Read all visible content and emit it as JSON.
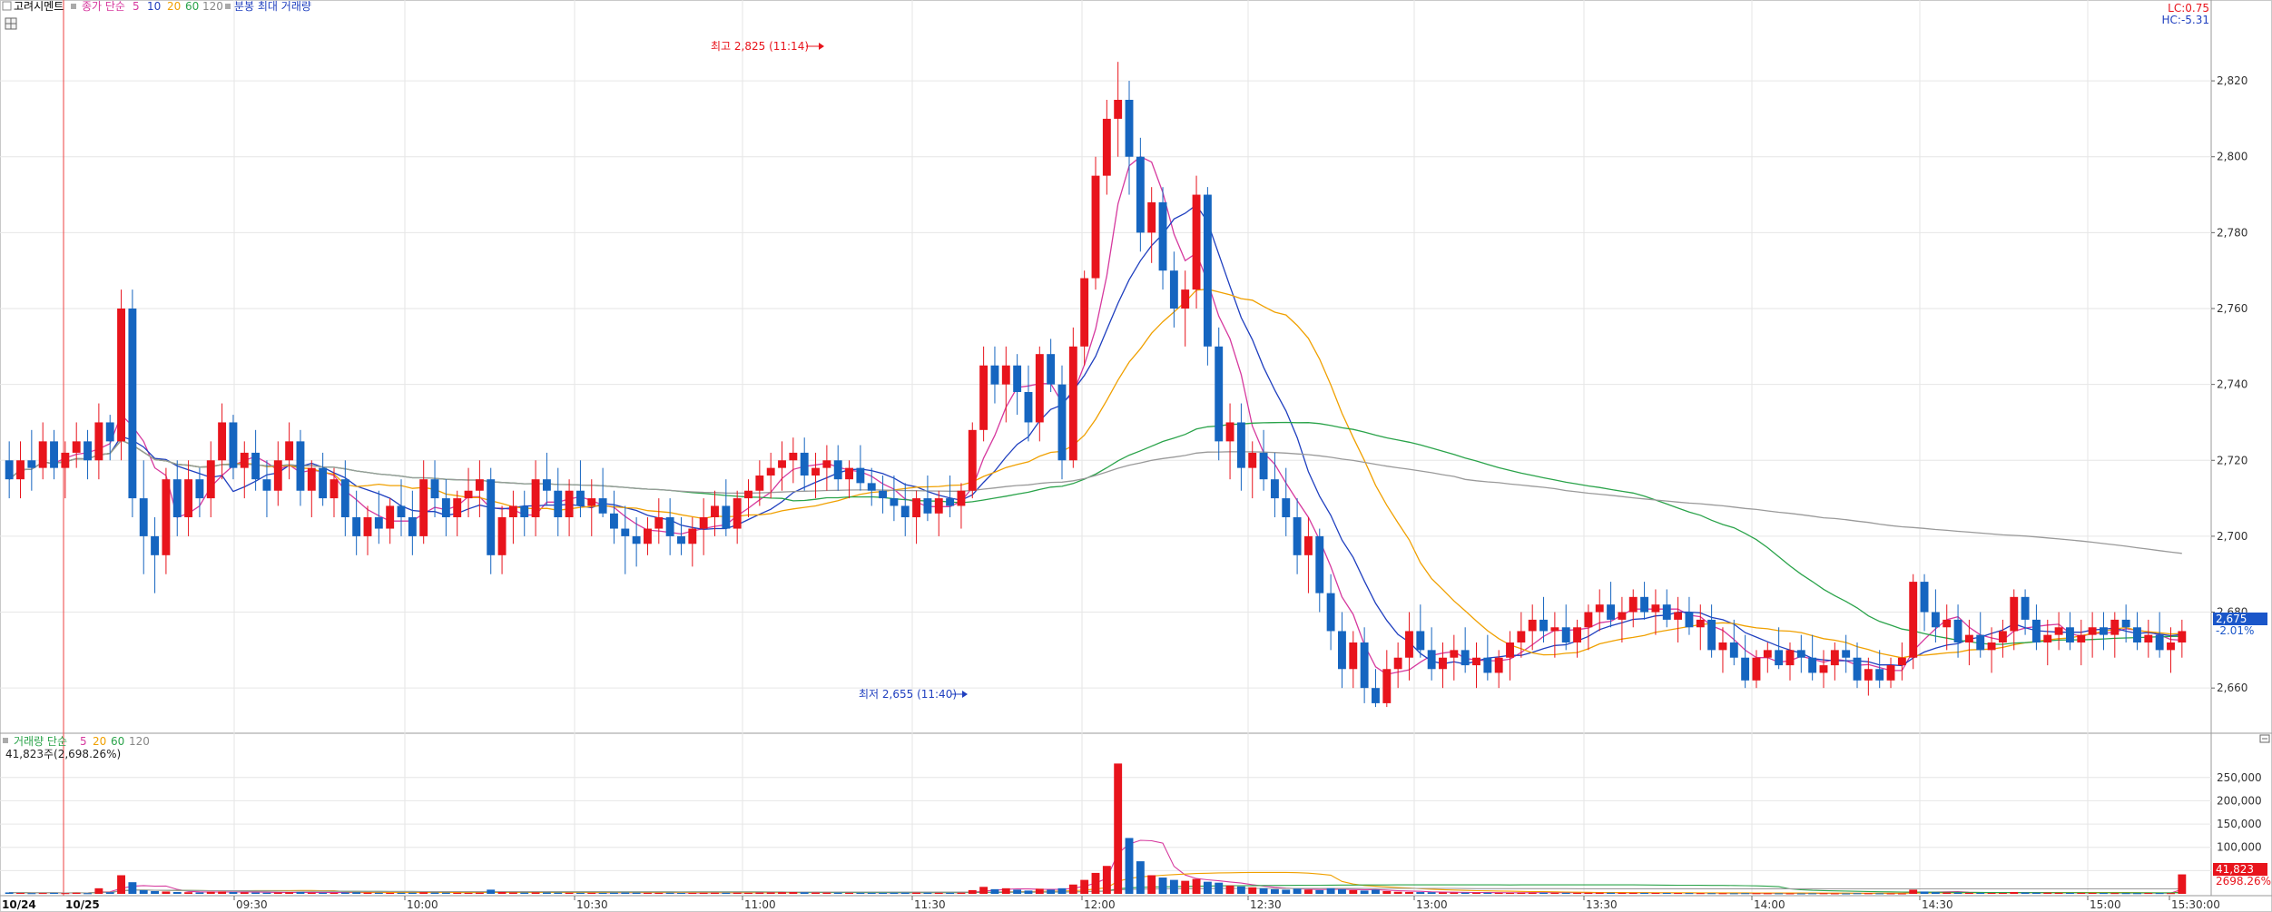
{
  "header": {
    "stock_name": "고려시멘트",
    "price_legend": {
      "label": "종가 단순",
      "periods": [
        "5",
        "10",
        "20",
        "60",
        "120"
      ]
    },
    "extra_label": "분봉 최대 거래량",
    "lc": "LC:0.75",
    "hc": "HC:-5.31"
  },
  "volume_header": {
    "label": "거래량 단순",
    "periods": [
      "5",
      "20",
      "60",
      "120"
    ],
    "summary": "41,823주(2,698.26%)"
  },
  "colors": {
    "up": "#e8141c",
    "down": "#1565c0",
    "ma5": "#d6399e",
    "ma10": "#1f3fbf",
    "ma20": "#f0a000",
    "ma60": "#2aa34a",
    "ma120": "#9a9a9a",
    "grid": "#e6e6e6",
    "price_tag_bg": "#1a56c9",
    "vol_tag_bg": "#e8141c"
  },
  "annotations": {
    "high": "최고 2,825 (11:14)",
    "low": "최저 2,655 (11:40)"
  },
  "price_tag": {
    "price": "2,675",
    "change": "-2.01%"
  },
  "volume_tag": {
    "value": "41,823",
    "pct": "2698.26%"
  },
  "chart_data": {
    "type": "candlestick",
    "interval": "1 minute",
    "y_axis": {
      "ticks": [
        "2,820",
        "2,800",
        "2,780",
        "2,760",
        "2,740",
        "2,720",
        "2,700",
        "2,680",
        "2,660"
      ],
      "range": [
        2650,
        2837
      ]
    },
    "volume_axis": {
      "ticks": [
        "250,000",
        "200,000",
        "150,000",
        "100,000",
        "50,000"
      ],
      "range": [
        0,
        310000
      ]
    },
    "x_axis": {
      "date_labels": [
        "10/24",
        "10/25"
      ],
      "time_labels": [
        "09:30",
        "10:00",
        "10:30",
        "11:00",
        "11:30",
        "12:00",
        "12:30",
        "13:00",
        "13:30",
        "14:00",
        "14:30",
        "15:00",
        "15:30:00"
      ]
    },
    "high": {
      "price": 2825,
      "time": "11:14"
    },
    "low": {
      "price": 2655,
      "time": "11:40"
    },
    "last": {
      "price": 2675,
      "change_pct": -2.01
    },
    "volume_last": 41823,
    "candles": [
      [
        2720,
        2725,
        2710,
        2715,
        3000
      ],
      [
        2715,
        2725,
        2710,
        2720,
        2000
      ],
      [
        2720,
        2728,
        2712,
        2718,
        1500
      ],
      [
        2718,
        2730,
        2715,
        2725,
        1800
      ],
      [
        2725,
        2728,
        2715,
        2718,
        2200
      ],
      [
        2718,
        2725,
        2710,
        2722,
        1600
      ],
      [
        2722,
        2730,
        2718,
        2725,
        2500
      ],
      [
        2725,
        2728,
        2715,
        2720,
        1400
      ],
      [
        2720,
        2735,
        2715,
        2730,
        12000
      ],
      [
        2730,
        2732,
        2720,
        2725,
        3500
      ],
      [
        2725,
        2765,
        2720,
        2760,
        40000
      ],
      [
        2760,
        2765,
        2705,
        2710,
        25000
      ],
      [
        2710,
        2720,
        2690,
        2700,
        8000
      ],
      [
        2700,
        2705,
        2685,
        2695,
        6000
      ],
      [
        2695,
        2718,
        2690,
        2715,
        5000
      ],
      [
        2715,
        2720,
        2700,
        2705,
        4000
      ],
      [
        2705,
        2720,
        2700,
        2715,
        3500
      ],
      [
        2715,
        2718,
        2705,
        2710,
        3000
      ],
      [
        2710,
        2725,
        2705,
        2720,
        4500
      ],
      [
        2720,
        2735,
        2715,
        2730,
        5000
      ],
      [
        2730,
        2732,
        2715,
        2718,
        3800
      ],
      [
        2718,
        2725,
        2710,
        2722,
        3200
      ],
      [
        2722,
        2728,
        2712,
        2715,
        2800
      ],
      [
        2715,
        2720,
        2705,
        2712,
        2500
      ],
      [
        2712,
        2725,
        2708,
        2720,
        3000
      ],
      [
        2720,
        2730,
        2715,
        2725,
        3500
      ],
      [
        2725,
        2728,
        2708,
        2712,
        4000
      ],
      [
        2712,
        2720,
        2705,
        2718,
        2600
      ],
      [
        2718,
        2722,
        2708,
        2710,
        2400
      ],
      [
        2710,
        2718,
        2705,
        2715,
        2200
      ],
      [
        2715,
        2720,
        2700,
        2705,
        3000
      ],
      [
        2705,
        2712,
        2695,
        2700,
        3600
      ],
      [
        2700,
        2708,
        2695,
        2705,
        2800
      ],
      [
        2705,
        2712,
        2698,
        2702,
        2500
      ],
      [
        2702,
        2710,
        2698,
        2708,
        2200
      ],
      [
        2708,
        2715,
        2700,
        2705,
        2400
      ],
      [
        2705,
        2712,
        2695,
        2700,
        2600
      ],
      [
        2700,
        2720,
        2698,
        2715,
        3500
      ],
      [
        2715,
        2720,
        2705,
        2710,
        3000
      ],
      [
        2710,
        2715,
        2700,
        2705,
        2800
      ],
      [
        2705,
        2712,
        2700,
        2710,
        2400
      ],
      [
        2710,
        2718,
        2705,
        2712,
        2200
      ],
      [
        2712,
        2720,
        2705,
        2715,
        2600
      ],
      [
        2715,
        2718,
        2690,
        2695,
        9000
      ],
      [
        2695,
        2708,
        2690,
        2705,
        4000
      ],
      [
        2705,
        2712,
        2698,
        2708,
        3000
      ],
      [
        2708,
        2712,
        2700,
        2705,
        2800
      ],
      [
        2705,
        2720,
        2700,
        2715,
        3200
      ],
      [
        2715,
        2722,
        2708,
        2712,
        3000
      ],
      [
        2712,
        2718,
        2700,
        2705,
        2600
      ],
      [
        2705,
        2715,
        2700,
        2712,
        2400
      ],
      [
        2712,
        2720,
        2705,
        2708,
        2200
      ],
      [
        2708,
        2715,
        2700,
        2710,
        2300
      ],
      [
        2710,
        2718,
        2705,
        2706,
        2100
      ],
      [
        2706,
        2712,
        2698,
        2702,
        2500
      ],
      [
        2702,
        2708,
        2690,
        2700,
        2800
      ],
      [
        2700,
        2705,
        2692,
        2698,
        2600
      ],
      [
        2698,
        2705,
        2695,
        2702,
        2300
      ],
      [
        2702,
        2710,
        2698,
        2705,
        2200
      ],
      [
        2705,
        2710,
        2695,
        2700,
        2400
      ],
      [
        2700,
        2705,
        2695,
        2698,
        2000
      ],
      [
        2698,
        2705,
        2692,
        2702,
        2100
      ],
      [
        2702,
        2710,
        2695,
        2705,
        2300
      ],
      [
        2705,
        2712,
        2700,
        2708,
        2500
      ],
      [
        2708,
        2715,
        2700,
        2702,
        2400
      ],
      [
        2702,
        2712,
        2698,
        2710,
        2600
      ],
      [
        2710,
        2715,
        2705,
        2712,
        2300
      ],
      [
        2712,
        2720,
        2708,
        2716,
        3000
      ],
      [
        2716,
        2722,
        2710,
        2718,
        3200
      ],
      [
        2718,
        2725,
        2712,
        2720,
        3600
      ],
      [
        2720,
        2726,
        2714,
        2722,
        3800
      ],
      [
        2722,
        2726,
        2712,
        2716,
        3400
      ],
      [
        2716,
        2722,
        2710,
        2718,
        3000
      ],
      [
        2718,
        2724,
        2712,
        2720,
        2800
      ],
      [
        2720,
        2724,
        2712,
        2715,
        2600
      ],
      [
        2715,
        2720,
        2710,
        2718,
        2400
      ],
      [
        2718,
        2724,
        2712,
        2714,
        2300
      ],
      [
        2714,
        2718,
        2708,
        2712,
        2200
      ],
      [
        2712,
        2716,
        2706,
        2710,
        2100
      ],
      [
        2710,
        2716,
        2704,
        2708,
        2400
      ],
      [
        2708,
        2714,
        2700,
        2705,
        2600
      ],
      [
        2705,
        2712,
        2698,
        2710,
        2800
      ],
      [
        2710,
        2716,
        2704,
        2706,
        2500
      ],
      [
        2706,
        2712,
        2700,
        2710,
        2400
      ],
      [
        2710,
        2716,
        2705,
        2708,
        2300
      ],
      [
        2708,
        2714,
        2702,
        2712,
        2600
      ],
      [
        2712,
        2730,
        2710,
        2728,
        8000
      ],
      [
        2728,
        2750,
        2725,
        2745,
        15000
      ],
      [
        2745,
        2750,
        2735,
        2740,
        10000
      ],
      [
        2740,
        2750,
        2730,
        2745,
        12000
      ],
      [
        2745,
        2748,
        2732,
        2738,
        9000
      ],
      [
        2738,
        2745,
        2725,
        2730,
        7000
      ],
      [
        2730,
        2750,
        2725,
        2748,
        11000
      ],
      [
        2748,
        2752,
        2738,
        2740,
        9000
      ],
      [
        2740,
        2745,
        2715,
        2720,
        12000
      ],
      [
        2720,
        2755,
        2718,
        2750,
        20000
      ],
      [
        2750,
        2770,
        2745,
        2768,
        30000
      ],
      [
        2768,
        2800,
        2765,
        2795,
        45000
      ],
      [
        2795,
        2815,
        2790,
        2810,
        60000
      ],
      [
        2810,
        2825,
        2800,
        2815,
        280000
      ],
      [
        2815,
        2820,
        2790,
        2800,
        120000
      ],
      [
        2800,
        2805,
        2775,
        2780,
        70000
      ],
      [
        2780,
        2792,
        2772,
        2788,
        40000
      ],
      [
        2788,
        2792,
        2765,
        2770,
        35000
      ],
      [
        2770,
        2775,
        2755,
        2760,
        30000
      ],
      [
        2760,
        2770,
        2750,
        2765,
        28000
      ],
      [
        2765,
        2795,
        2760,
        2790,
        32000
      ],
      [
        2790,
        2792,
        2745,
        2750,
        26000
      ],
      [
        2750,
        2755,
        2720,
        2725,
        24000
      ],
      [
        2725,
        2735,
        2715,
        2730,
        18000
      ],
      [
        2730,
        2735,
        2712,
        2718,
        16000
      ],
      [
        2718,
        2725,
        2710,
        2722,
        14000
      ],
      [
        2722,
        2728,
        2712,
        2715,
        12000
      ],
      [
        2715,
        2722,
        2705,
        2710,
        10000
      ],
      [
        2710,
        2718,
        2700,
        2705,
        9000
      ],
      [
        2705,
        2710,
        2690,
        2695,
        11000
      ],
      [
        2695,
        2705,
        2685,
        2700,
        9000
      ],
      [
        2700,
        2702,
        2680,
        2685,
        8000
      ],
      [
        2685,
        2690,
        2670,
        2675,
        12000
      ],
      [
        2675,
        2680,
        2660,
        2665,
        10000
      ],
      [
        2665,
        2675,
        2660,
        2672,
        8000
      ],
      [
        2672,
        2676,
        2656,
        2660,
        7000
      ],
      [
        2660,
        2665,
        2655,
        2656,
        9000
      ],
      [
        2656,
        2670,
        2655,
        2665,
        6000
      ],
      [
        2665,
        2672,
        2660,
        2668,
        4500
      ],
      [
        2668,
        2680,
        2662,
        2675,
        4000
      ],
      [
        2675,
        2682,
        2668,
        2670,
        3800
      ],
      [
        2670,
        2676,
        2662,
        2665,
        3500
      ],
      [
        2665,
        2672,
        2660,
        2668,
        3000
      ],
      [
        2668,
        2674,
        2662,
        2670,
        2800
      ],
      [
        2670,
        2676,
        2664,
        2666,
        2600
      ],
      [
        2666,
        2672,
        2660,
        2668,
        2500
      ],
      [
        2668,
        2674,
        2662,
        2664,
        2400
      ],
      [
        2664,
        2670,
        2660,
        2668,
        2300
      ],
      [
        2668,
        2675,
        2662,
        2672,
        2200
      ],
      [
        2672,
        2680,
        2668,
        2675,
        2600
      ],
      [
        2675,
        2682,
        2670,
        2678,
        2800
      ],
      [
        2678,
        2684,
        2672,
        2675,
        2500
      ],
      [
        2675,
        2680,
        2668,
        2676,
        2400
      ],
      [
        2676,
        2682,
        2670,
        2672,
        2300
      ],
      [
        2672,
        2678,
        2668,
        2676,
        2200
      ],
      [
        2676,
        2682,
        2670,
        2680,
        2400
      ],
      [
        2680,
        2686,
        2675,
        2682,
        2600
      ],
      [
        2682,
        2688,
        2676,
        2678,
        2500
      ],
      [
        2678,
        2684,
        2672,
        2680,
        2300
      ],
      [
        2680,
        2686,
        2676,
        2684,
        2200
      ],
      [
        2684,
        2688,
        2678,
        2680,
        2100
      ],
      [
        2680,
        2686,
        2674,
        2682,
        2000
      ],
      [
        2682,
        2686,
        2676,
        2678,
        1900
      ],
      [
        2678,
        2684,
        2672,
        2680,
        1800
      ],
      [
        2680,
        2684,
        2674,
        2676,
        1700
      ],
      [
        2676,
        2682,
        2670,
        2678,
        1600
      ],
      [
        2678,
        2682,
        2668,
        2670,
        1500
      ],
      [
        2670,
        2676,
        2664,
        2672,
        1400
      ],
      [
        2672,
        2678,
        2666,
        2668,
        1300
      ],
      [
        2668,
        2674,
        2660,
        2662,
        1500
      ],
      [
        2662,
        2670,
        2660,
        2668,
        1400
      ],
      [
        2668,
        2672,
        2664,
        2670,
        1300
      ],
      [
        2670,
        2676,
        2665,
        2666,
        1200
      ],
      [
        2666,
        2672,
        2662,
        2670,
        1100
      ],
      [
        2670,
        2674,
        2664,
        2668,
        1000
      ],
      [
        2668,
        2674,
        2662,
        2664,
        1200
      ],
      [
        2664,
        2670,
        2660,
        2666,
        1300
      ],
      [
        2666,
        2672,
        2662,
        2670,
        1100
      ],
      [
        2670,
        2674,
        2664,
        2668,
        1000
      ],
      [
        2668,
        2672,
        2660,
        2662,
        1400
      ],
      [
        2662,
        2668,
        2658,
        2665,
        1300
      ],
      [
        2665,
        2670,
        2660,
        2662,
        1200
      ],
      [
        2662,
        2668,
        2660,
        2666,
        1100
      ],
      [
        2666,
        2672,
        2662,
        2668,
        1000
      ],
      [
        2668,
        2690,
        2665,
        2688,
        9000
      ],
      [
        2688,
        2690,
        2675,
        2680,
        5000
      ],
      [
        2680,
        2686,
        2672,
        2676,
        3500
      ],
      [
        2676,
        2682,
        2670,
        2678,
        3000
      ],
      [
        2678,
        2682,
        2668,
        2672,
        2600
      ],
      [
        2672,
        2678,
        2666,
        2674,
        2400
      ],
      [
        2674,
        2680,
        2668,
        2670,
        2200
      ],
      [
        2670,
        2676,
        2664,
        2672,
        2000
      ],
      [
        2672,
        2678,
        2668,
        2675,
        1900
      ],
      [
        2675,
        2686,
        2670,
        2684,
        4000
      ],
      [
        2684,
        2686,
        2674,
        2678,
        3000
      ],
      [
        2678,
        2682,
        2670,
        2672,
        2600
      ],
      [
        2672,
        2678,
        2666,
        2674,
        2400
      ],
      [
        2674,
        2680,
        2670,
        2676,
        2200
      ],
      [
        2676,
        2680,
        2670,
        2672,
        2100
      ],
      [
        2672,
        2678,
        2666,
        2674,
        2000
      ],
      [
        2674,
        2680,
        2668,
        2676,
        1900
      ],
      [
        2676,
        2680,
        2670,
        2674,
        1800
      ],
      [
        2674,
        2680,
        2668,
        2678,
        1700
      ],
      [
        2678,
        2682,
        2672,
        2676,
        1600
      ],
      [
        2676,
        2680,
        2670,
        2672,
        1500
      ],
      [
        2672,
        2678,
        2668,
        2674,
        1800
      ],
      [
        2674,
        2680,
        2668,
        2670,
        1700
      ],
      [
        2670,
        2676,
        2664,
        2672,
        1600
      ],
      [
        2672,
        2678,
        2668,
        2675,
        41823
      ]
    ]
  }
}
